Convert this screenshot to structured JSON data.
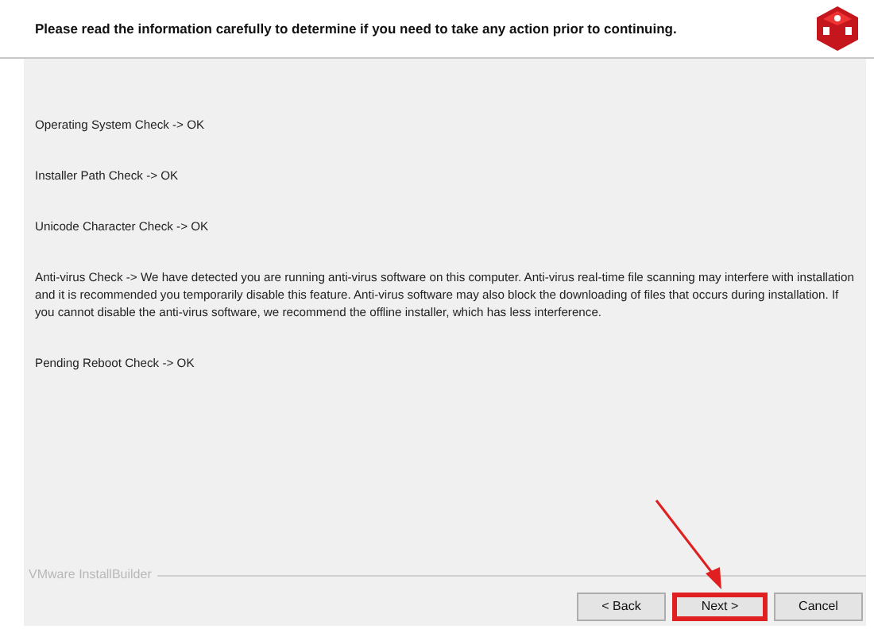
{
  "header": {
    "title": "Please read the information carefully to determine if you need to take any action prior to continuing."
  },
  "checks": [
    {
      "text": "Operating System Check -> OK"
    },
    {
      "text": "Installer Path Check -> OK"
    },
    {
      "text": "Unicode Character Check ->  OK"
    },
    {
      "text": "Anti-virus Check -> We have detected you are running anti-virus software on this computer. Anti-virus real-time file scanning may interfere with installation and it is recommended you temporarily disable this feature. Anti-virus software may also block the downloading of files that occurs during installation. If you cannot disable the anti-virus software, we recommend the offline installer, which has less interference."
    },
    {
      "text": "Pending Reboot Check -> OK"
    }
  ],
  "footer": {
    "brand": "VMware InstallBuilder"
  },
  "buttons": [
    {
      "label": "< Back",
      "highlighted": false
    },
    {
      "label": "Next >",
      "highlighted": true
    },
    {
      "label": "Cancel",
      "highlighted": false
    }
  ]
}
